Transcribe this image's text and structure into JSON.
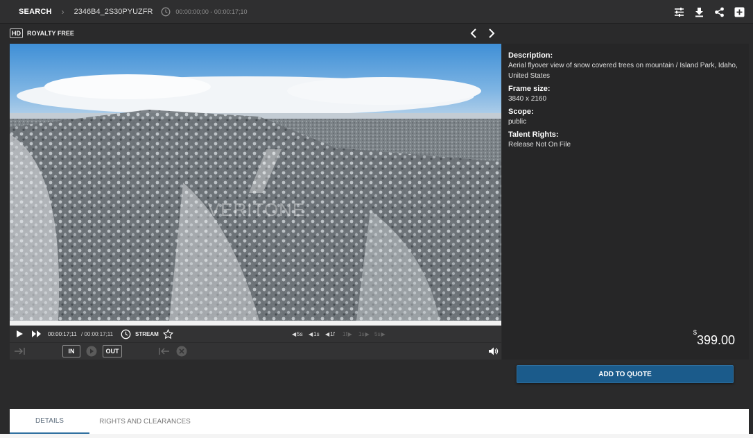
{
  "header": {
    "breadcrumb_search": "SEARCH",
    "clip_id": "2346B4_2S30PYUZFR",
    "time_range": "00:00:00;00 - 00:00:17;10",
    "actions": [
      "sliders-icon",
      "download-icon",
      "share-icon",
      "add-icon"
    ]
  },
  "badges": {
    "hd": "HD",
    "license": "ROYALTY FREE"
  },
  "video": {
    "watermark": "VERITONE"
  },
  "player": {
    "current_time": "00:00:17;11",
    "duration": "/ 00:00:17;11",
    "stream_label": "STREAM",
    "step_back": [
      "5s",
      "1s",
      "1f"
    ],
    "step_fwd": [
      "1f",
      "1s",
      "5s"
    ],
    "in_label": "IN",
    "out_label": "OUT",
    "progress": 1.0
  },
  "details": {
    "description_label": "Description:",
    "description_value": "Aerial flyover view of snow covered trees on mountain / Island Park, Idaho, United States",
    "frame_label": "Frame size:",
    "frame_value": "3840 x 2160",
    "scope_label": "Scope:",
    "scope_value": "public",
    "talent_label": "Talent Rights:",
    "talent_value": "Release Not On File",
    "currency": "$",
    "price": "399.00"
  },
  "add_to_quote": "ADD TO QUOTE",
  "tabs": [
    {
      "label": "DETAILS",
      "active": true
    },
    {
      "label": "RIGHTS AND CLEARANCES",
      "active": false
    }
  ],
  "colors": {
    "accent": "#1b5b8b",
    "background": "#2a2a2b"
  }
}
